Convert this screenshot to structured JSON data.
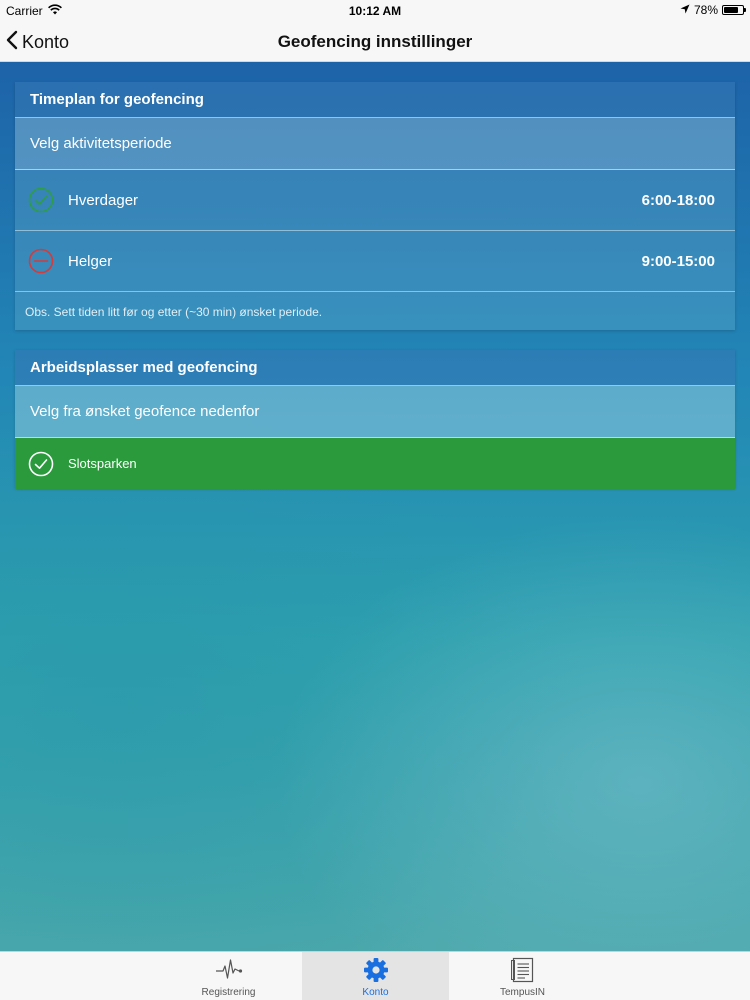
{
  "status_bar": {
    "carrier": "Carrier",
    "time": "10:12 AM",
    "battery_percent": "78%",
    "battery_level": 0.78
  },
  "nav_bar": {
    "back_label": "Konto",
    "title": "Geofencing innstillinger"
  },
  "schedule_card": {
    "header": "Timeplan for geofencing",
    "subheader": "Velg aktivitetsperiode",
    "rows": [
      {
        "label": "Hverdager",
        "value": "6:00-18:00",
        "status": "enabled",
        "icon": "check-circle-icon"
      },
      {
        "label": "Helger",
        "value": "9:00-15:00",
        "status": "disabled",
        "icon": "minus-circle-icon"
      }
    ],
    "note": "Obs. Sett tiden litt før og etter (~30 min) ønsket periode."
  },
  "workplaces_card": {
    "header": "Arbeidsplasser med geofencing",
    "subheader": "Velg fra ønsket geofence nedenfor",
    "items": [
      {
        "label": "Slotsparken",
        "selected": true,
        "icon": "check-circle-icon"
      }
    ]
  },
  "tab_bar": {
    "tabs": [
      {
        "label": "Registrering",
        "icon": "heartbeat-icon",
        "active": false
      },
      {
        "label": "Konto",
        "icon": "gear-icon",
        "active": true
      },
      {
        "label": "TempusIN",
        "icon": "document-icon",
        "active": false
      }
    ]
  },
  "colors": {
    "enabled": "#2e9d46",
    "disabled": "#d63a3a",
    "selected_row": "#2a9a3c",
    "active_tab": "#1a6fe0"
  }
}
